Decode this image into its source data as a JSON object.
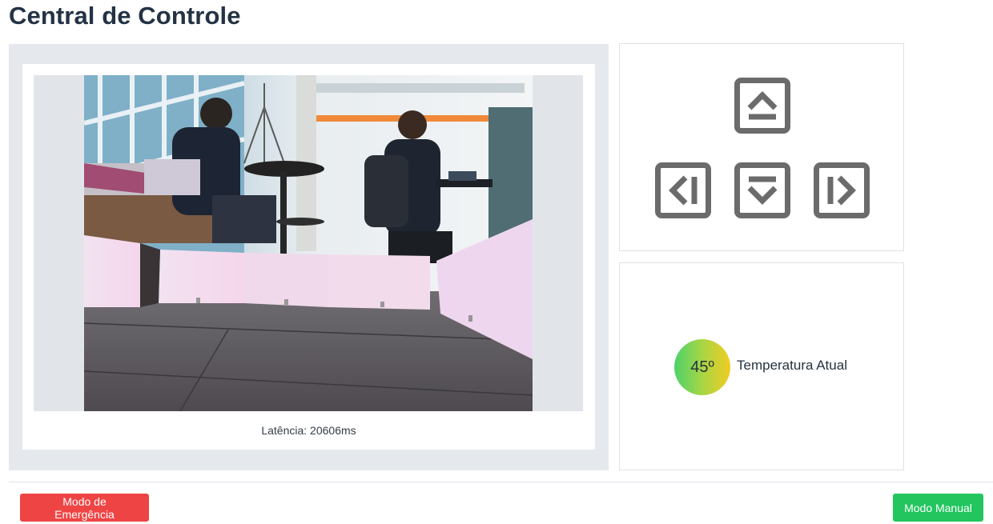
{
  "header": {
    "title": "Central de Controle"
  },
  "video": {
    "latency_text": "Latência: 20606ms"
  },
  "controls": {
    "up_icon": "arrow-up-square-icon",
    "left_icon": "arrow-left-square-icon",
    "down_icon": "arrow-down-square-icon",
    "right_icon": "arrow-right-square-icon"
  },
  "temperature": {
    "value": "45º",
    "label": "Temperatura Atual"
  },
  "footer": {
    "emergency_label": "Modo de Emergência",
    "manual_label": "Modo Manual"
  },
  "colors": {
    "title": "#233345",
    "emergency": "#ef4444",
    "manual": "#22c55e",
    "icon": "#6b6b6b"
  }
}
